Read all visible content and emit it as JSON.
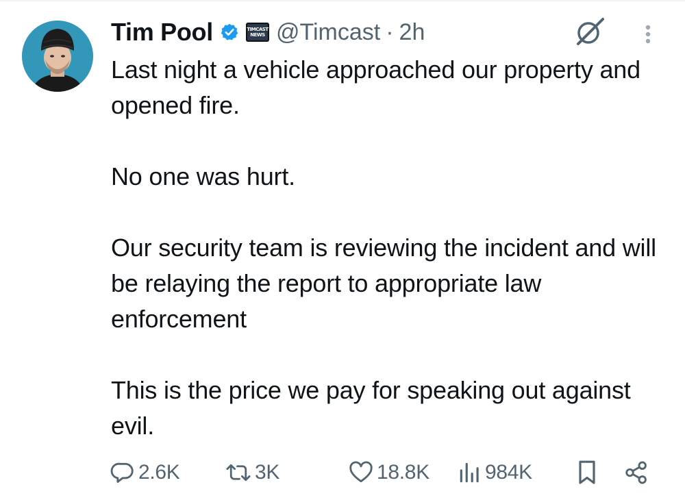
{
  "author": {
    "name": "Tim Pool",
    "handle": "@Timcast",
    "separator": "·",
    "time": "2h",
    "affiliate_badge": [
      "TIMCAST",
      "NEWS"
    ],
    "verified_color": "#1d9bf0"
  },
  "tweet": {
    "text": "Last night a vehicle approached our property and opened fire.\n\nNo one was hurt.\n\nOur security team is reviewing the incident and will be relaying the report to appropriate law enforcement\n\nThis is the price we pay for speaking out against evil."
  },
  "actions": {
    "replies": "2.6K",
    "reposts": "3K",
    "likes": "18.8K",
    "views": "984K"
  },
  "icons": {
    "avatar": "profile-avatar",
    "verified": "verified-badge-icon",
    "grok": "grok-icon",
    "more": "more-vertical-icon",
    "reply": "reply-icon",
    "repost": "repost-icon",
    "like": "heart-icon",
    "views": "views-chart-icon",
    "bookmark": "bookmark-icon",
    "share": "share-icon"
  },
  "colors": {
    "text": "#0f1419",
    "secondary": "#536471",
    "accent": "#1d9bf0"
  }
}
